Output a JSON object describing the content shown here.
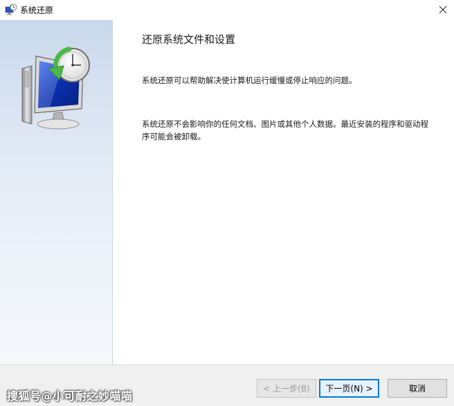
{
  "window": {
    "title": "系统还原",
    "title_icon": "system-restore-icon",
    "close_icon": "close-icon"
  },
  "sidebar": {
    "hero_icon": "system-restore-monitor-clock-icon"
  },
  "main": {
    "heading": "还原系统文件和设置",
    "paragraph1": "系统还原可以帮助解决使计算机运行缓慢或停止响应的问题。",
    "paragraph2": "系统还原不会影响你的任何文档、图片或其他个人数据。最近安装的程序和驱动程序可能会被卸载。"
  },
  "footer": {
    "watermark": "搜狐号@小可耐之妙喵喵",
    "back_label": "< 上一步(B)",
    "next_label": "下一页(N) >",
    "cancel_label": "取消"
  },
  "colors": {
    "accent": "#0078d7",
    "sidebar_top": "#cad8ec",
    "sidebar_bottom": "#f6f8fc",
    "footer_bg": "#f0f0f0"
  }
}
